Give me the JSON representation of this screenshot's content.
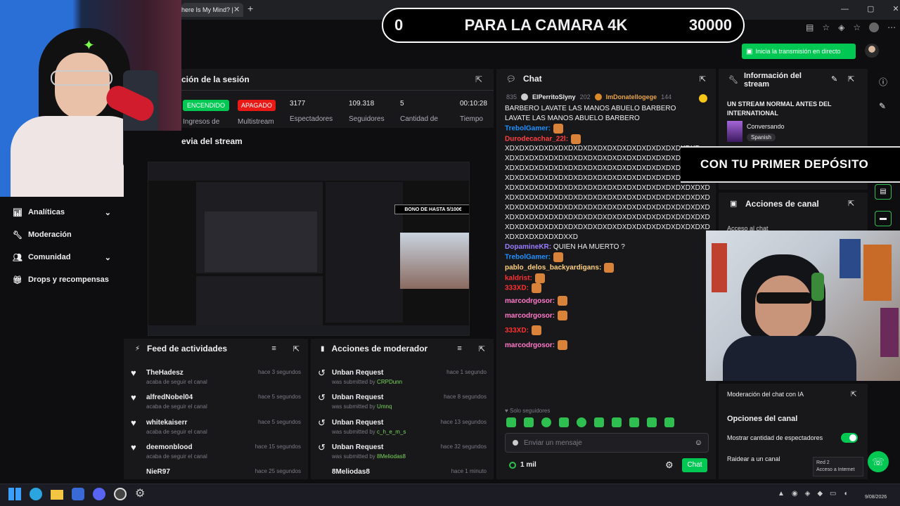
{
  "browser": {
    "tab_title": "here Is My Mind? |",
    "new_tab": "+"
  },
  "top_banner": {
    "left": "0",
    "center": "PARA LA CAMARA 4K",
    "right": "30000"
  },
  "go_live_button": "Inicia la transmisión en directo",
  "session": {
    "title": "ción de la sesión",
    "encendido": "ENCENDIDO",
    "apagado": "APAGADO",
    "stats": [
      {
        "value": "",
        "label": "Ingresos de"
      },
      {
        "value": "",
        "label": "Multistream"
      },
      {
        "value": "3177",
        "label": "Espectadores"
      },
      {
        "value": "109.318",
        "label": "Seguidores"
      },
      {
        "value": "5",
        "label": "Cantidad de"
      },
      {
        "value": "00:10:28",
        "label": "Tiempo"
      }
    ]
  },
  "preview": {
    "title": "evia del stream",
    "inner_banner": "BONO DE HASTA 5/100€"
  },
  "sidebar": [
    {
      "label": "Analíticas",
      "icon": "chart-icon",
      "chevron": true
    },
    {
      "label": "Moderación",
      "icon": "wrench-icon",
      "chevron": false
    },
    {
      "label": "Comunidad",
      "icon": "people-icon",
      "chevron": true
    },
    {
      "label": "Drops y recompensas",
      "icon": "gift-icon",
      "chevron": false
    }
  ],
  "feed": {
    "title": "Feed de actividades",
    "items": [
      {
        "name": "TheHadesz",
        "sub": "acaba de seguir el canal",
        "time": "hace 3 segundos"
      },
      {
        "name": "alfredNobel04",
        "sub": "acaba de seguir el canal",
        "time": "hace 5 segundos"
      },
      {
        "name": "whitekaiserr",
        "sub": "acaba de seguir el canal",
        "time": "hace 5 segundos"
      },
      {
        "name": "deemonblood",
        "sub": "acaba de seguir el canal",
        "time": "hace 15 segundos"
      },
      {
        "name": "NieR97",
        "sub": "",
        "time": "hace 25 segundos"
      }
    ]
  },
  "mod_actions": {
    "title": "Acciones de moderador",
    "items": [
      {
        "name": "Unban Request",
        "sub": "was submitted by",
        "user": "CRPDunn",
        "time": "hace 1 segundo"
      },
      {
        "name": "Unban Request",
        "sub": "was submitted by",
        "user": "Umnq",
        "time": "hace 8 segundos"
      },
      {
        "name": "Unban Request",
        "sub": "was submitted by",
        "user": "c_h_e_m_s",
        "time": "hace 13 segundos"
      },
      {
        "name": "Unban Request",
        "sub": "was submitted by",
        "user": "8Meliodas8",
        "time": "hace 32 segundos"
      },
      {
        "name": "8Meliodas8",
        "sub": "",
        "user": "",
        "time": "hace 1 minuto"
      }
    ]
  },
  "chat": {
    "title": "Chat",
    "top_bar": {
      "count_left": "835",
      "user1": "ElPerritoSlyny",
      "count1": "202",
      "user2": "ImDonatellogege",
      "count2": "144"
    },
    "lines": [
      {
        "user": "",
        "text": "BARBERO   LAVATE LAS MANOS ABUELO BARBERO",
        "color": "#efeff1"
      },
      {
        "user": "",
        "text": "LAVATE LAS MANOS ABUELO BARBERO",
        "color": "#efeff1"
      },
      {
        "user": "TrebolGamer:",
        "text": "",
        "color": "#1e90ff"
      },
      {
        "user": "Durodecachar_22l:",
        "text": "",
        "color": "#ff4040"
      },
      {
        "user": "",
        "text": "XDXDXDXDXDXDXDXDXDXDXDXDXDXDXDXDXDXDXDXD",
        "color": "#efeff1"
      },
      {
        "user": "",
        "text": "XDXDXDXDXDXDXDXDXDXDXDXDXDXDXDXDXDXDXDXD",
        "color": "#efeff1"
      },
      {
        "user": "",
        "text": "XDXDXDXDXDXDXDXDXDXDXDXDXDXDXDXDXDXDXDXDXD",
        "color": "#efeff1"
      },
      {
        "user": "",
        "text": "XDXDXDXDXDXDXDXDXDXDXDXDXDXDXDXDXDXDXDXDXD",
        "color": "#efeff1"
      },
      {
        "user": "",
        "text": "XDXDXDXDXDXDXDXDXDXDXDXDXDXDXDXDXDXDXDXDXD",
        "color": "#efeff1"
      },
      {
        "user": "",
        "text": "XDXDXDXDXDXDXDXDXDXDXDXDXDXDXDXDXDXDXDXDXD",
        "color": "#efeff1"
      },
      {
        "user": "",
        "text": "XDXDXDXDXDXDXDXDXDXDXDXDXDXDXDXDXDXDXDXDXD",
        "color": "#efeff1"
      },
      {
        "user": "",
        "text": "XDXDXDXDXDXDXDXDXDXDXDXDXDXDXDXDXDXDXDXDXD",
        "color": "#efeff1"
      },
      {
        "user": "",
        "text": "XDXDXDXDXDXDXDXDXDXDXDXDXDXDXDXDXDXDXDXDXD",
        "color": "#efeff1"
      },
      {
        "user": "",
        "text": "XDXDXDXDXDXDXXD",
        "color": "#efeff1"
      },
      {
        "user": "DopamineKR:",
        "text": "QUIEN HA MUERTO ?",
        "color": "#9b7dff"
      },
      {
        "user": "TrebolGamer:",
        "text": "",
        "color": "#1e90ff"
      },
      {
        "user": "pablo_delos_backyardigans:",
        "text": "",
        "color": "#ffd280"
      },
      {
        "user": "kaldrist:",
        "text": "",
        "color": "#ff3030"
      },
      {
        "user": "333XD:",
        "text": "",
        "color": "#ff3030"
      },
      {
        "user": "marcodrgosor:",
        "text": "",
        "color": "#ff7ac8"
      },
      {
        "user": "marcodrgosor:",
        "text": "",
        "color": "#ff7ac8"
      },
      {
        "user": "333XD:",
        "text": "",
        "color": "#ff3030"
      },
      {
        "user": "marcodrgosor:",
        "text": "",
        "color": "#ff7ac8"
      }
    ],
    "followers_only": "Solo seguidores",
    "input_placeholder": "Enviar un mensaje",
    "points": "1 mil",
    "send_label": "Chat"
  },
  "stream_info": {
    "title": "Información del stream",
    "stream_title": "UN STREAM NORMAL ANTES DEL INTERNATIONAL",
    "category": "Conversando",
    "language": "Spanish"
  },
  "overlay_banner": "CON TU PRIMER DEPÓSITO",
  "channel_actions": {
    "title": "Acciones de canal",
    "sub": "Acceso al chat"
  },
  "channel_opts": {
    "ai_mod": "Moderación del chat con IA",
    "title": "Opciones del canal",
    "show_viewers": "Mostrar cantidad de espectadores",
    "raid": "Raidear a un canal"
  },
  "network_tooltip": {
    "line1": "Red 2",
    "line2": "Acceso a Internet"
  },
  "taskbar": {
    "date": "9/08/2026"
  },
  "colors": {
    "accent": "#00c853",
    "bg": "#0e0e10",
    "panel": "#18181b",
    "twitch": "#9147ff"
  }
}
